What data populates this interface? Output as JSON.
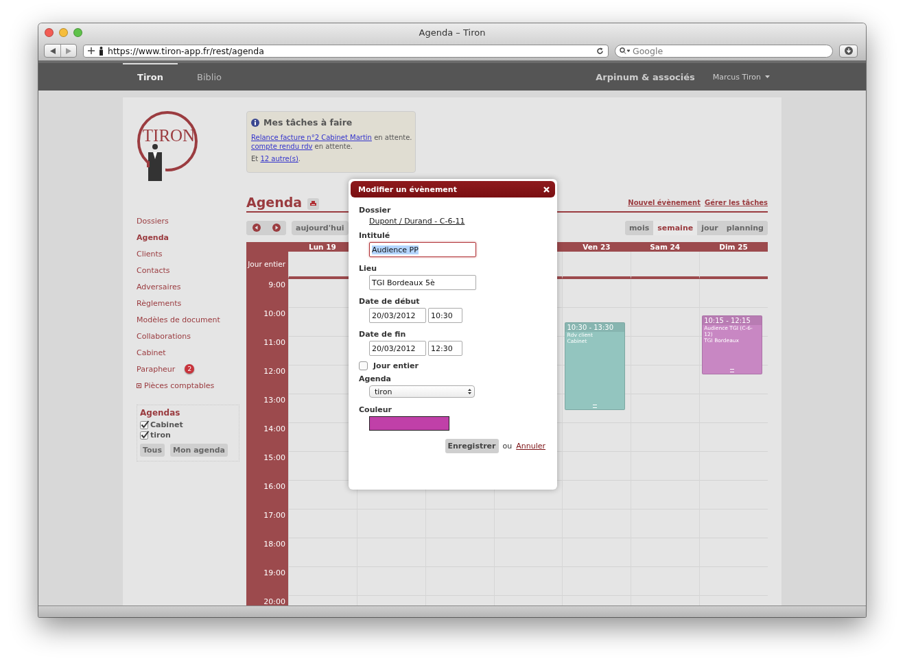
{
  "window": {
    "title": "Agenda – Tiron",
    "url": "https://www.tiron-app.fr/rest/agenda",
    "search_placeholder": "Google"
  },
  "nav": {
    "tabs": [
      {
        "label": "Tiron",
        "selected": true
      },
      {
        "label": "Biblio",
        "selected": false
      }
    ],
    "company": "Arpinum & associés",
    "user": "Marcus Tiron"
  },
  "logo": {
    "text": "TIRON"
  },
  "tasks": {
    "title": "Mes tâches à faire",
    "items": [
      {
        "link": "Relance facture n°2 Cabinet Martin",
        "status": "en attente."
      },
      {
        "link": "compte rendu rdv",
        "status": "en attente."
      }
    ],
    "more_prefix": "Et",
    "more_link": "12 autre(s)",
    "more_suffix": "."
  },
  "sidebar": {
    "items": [
      {
        "label": "Dossiers",
        "selected": false
      },
      {
        "label": "Agenda",
        "selected": true
      },
      {
        "label": "Clients",
        "selected": false
      },
      {
        "label": "Contacts",
        "selected": false
      },
      {
        "label": "Adversaires",
        "selected": false
      },
      {
        "label": "Règlements",
        "selected": false
      },
      {
        "label": "Modèles de document",
        "selected": false
      },
      {
        "label": "Collaborations",
        "selected": false
      },
      {
        "label": "Cabinet",
        "selected": false
      },
      {
        "label": "Parapheur",
        "selected": false,
        "badge": "2"
      },
      {
        "label": "Pièces comptables",
        "selected": false,
        "kind": "expandable"
      }
    ],
    "agendas": {
      "title": "Agendas",
      "items": [
        {
          "label": "Cabinet",
          "checked": true
        },
        {
          "label": "tiron",
          "checked": true
        }
      ],
      "buttons": [
        "Tous",
        "Mon agenda"
      ]
    }
  },
  "agenda": {
    "title": "Agenda",
    "links": [
      "Nouvel évènement",
      "Gérer les tâches"
    ],
    "today": "aujourd'hui",
    "views": [
      {
        "label": "mois",
        "selected": false
      },
      {
        "label": "semaine",
        "selected": true
      },
      {
        "label": "jour",
        "selected": false
      },
      {
        "label": "planning",
        "selected": false
      }
    ],
    "all_day_label": "Jour entier",
    "days": [
      {
        "kind": "day",
        "label": "Lun 19"
      },
      {
        "kind": "covered"
      },
      {
        "kind": "covered"
      },
      {
        "kind": "covered"
      },
      {
        "kind": "day",
        "label": "Ven 23",
        "events": [
          {
            "time": "10:30 - 13:30",
            "title": "Rdv client",
            "place": "Cabinet",
            "color": "#93c5bf"
          }
        ]
      },
      {
        "kind": "day",
        "label": "Sam 24"
      },
      {
        "kind": "day",
        "label": "Dim 25",
        "events": [
          {
            "time": "10:15 - 12:15",
            "title": "Audience TGI (C-6-12)",
            "place": "TGI Bordeaux",
            "color": "#c887c3"
          }
        ]
      }
    ],
    "hours": [
      "9:00",
      "10:00",
      "11:00",
      "12:00",
      "13:00",
      "14:00",
      "15:00",
      "16:00",
      "17:00",
      "18:00",
      "19:00",
      "20:00"
    ]
  },
  "dialog": {
    "title": "Modifier un évènement",
    "dossier_label": "Dossier",
    "dossier_link": "Dupont / Durand - C-6-11",
    "title_label": "Intitulé",
    "title_value": "Audience PP",
    "place_label": "Lieu",
    "place_value": "TGI Bordeaux 5è",
    "start_label": "Date de début",
    "start_date": "20/03/2012",
    "start_time": "10:30",
    "end_label": "Date de fin",
    "end_date": "20/03/2012",
    "end_time": "12:30",
    "all_day": {
      "label": "Jour entier",
      "checked": false
    },
    "agenda_label": "Agenda",
    "agenda_value": "tiron",
    "color_label": "Couleur",
    "color": "#c040a8",
    "save": "Enregistrer",
    "or": "ou",
    "cancel": "Annuler"
  }
}
